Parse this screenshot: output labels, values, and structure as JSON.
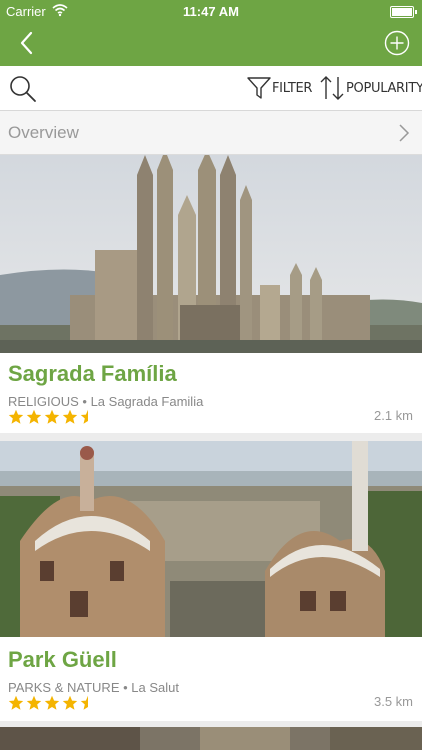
{
  "status": {
    "carrier": "Carrier",
    "time": "11:47 AM"
  },
  "toolbar": {
    "filter_label": "FILTER",
    "sort_label": "POPULARITY"
  },
  "overview": {
    "label": "Overview"
  },
  "colors": {
    "brand_green": "#6ea544",
    "star_yellow": "#f4b400"
  },
  "cards": [
    {
      "title": "Sagrada Família",
      "category": "RELIGIOUS",
      "location": "La Sagrada Familia",
      "rating": 4.5,
      "distance": "2.1 km"
    },
    {
      "title": "Park Güell",
      "category": "PARKS & NATURE",
      "location": "La Salut",
      "rating": 4.5,
      "distance": "3.5 km"
    }
  ]
}
